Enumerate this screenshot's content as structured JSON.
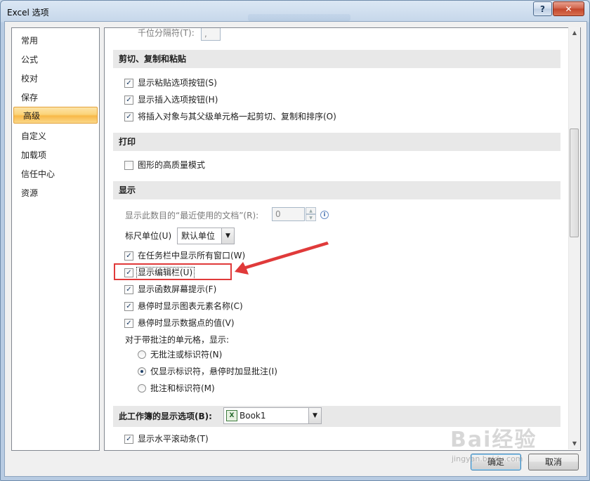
{
  "window": {
    "title": "Excel 选项",
    "help_symbol": "?",
    "close_symbol": "✕"
  },
  "sidebar": {
    "items": [
      {
        "label": "常用"
      },
      {
        "label": "公式"
      },
      {
        "label": "校对"
      },
      {
        "label": "保存"
      },
      {
        "label": "高级",
        "selected": true
      },
      {
        "label": "自定义"
      },
      {
        "label": "加载项"
      },
      {
        "label": "信任中心"
      },
      {
        "label": "资源"
      }
    ]
  },
  "main": {
    "thousands_separator": {
      "label": "千位分隔符(T):",
      "value": ","
    },
    "cut_copy_paste": {
      "header": "剪切、复制和粘贴",
      "options": [
        {
          "label": "显示粘贴选项按钮(S)",
          "checked": true
        },
        {
          "label": "显示插入选项按钮(H)",
          "checked": true
        },
        {
          "label": "将插入对象与其父级单元格一起剪切、复制和排序(O)",
          "checked": true
        }
      ]
    },
    "print": {
      "header": "打印",
      "options": [
        {
          "label": "图形的高质量模式",
          "checked": false
        }
      ]
    },
    "display": {
      "header": "显示",
      "recent_docs": {
        "label": "显示此数目的“最近使用的文档”(R):",
        "value": "0",
        "info_symbol": "i"
      },
      "ruler_units": {
        "label": "标尺单位(U)",
        "value": "默认单位"
      },
      "options": [
        {
          "label": "在任务栏中显示所有窗口(W)",
          "checked": true
        },
        {
          "label": "显示编辑栏(U)",
          "checked": true
        },
        {
          "label": "显示函数屏幕提示(F)",
          "checked": true
        },
        {
          "label": "悬停时显示图表元素名称(C)",
          "checked": true
        },
        {
          "label": "悬停时显示数据点的值(V)",
          "checked": true
        }
      ],
      "comments_label": "对于带批注的单元格，显示:",
      "comment_modes": [
        {
          "label": "无批注或标识符(N)",
          "selected": false
        },
        {
          "label": "仅显示标识符，悬停时加显批注(I)",
          "selected": true
        },
        {
          "label": "批注和标识符(M)",
          "selected": false
        }
      ]
    },
    "workbook_display": {
      "header": "此工作簿的显示选项(B):",
      "workbook": "Book1",
      "options": [
        {
          "label": "显示水平滚动条(T)",
          "checked": true
        }
      ]
    }
  },
  "footer": {
    "ok_label": "确定",
    "cancel_label": "取消"
  },
  "annotation": {
    "arrow_color": "#e03a3a"
  },
  "watermark": {
    "text": "Bai经验",
    "url": "jingyan.baidu.com"
  }
}
